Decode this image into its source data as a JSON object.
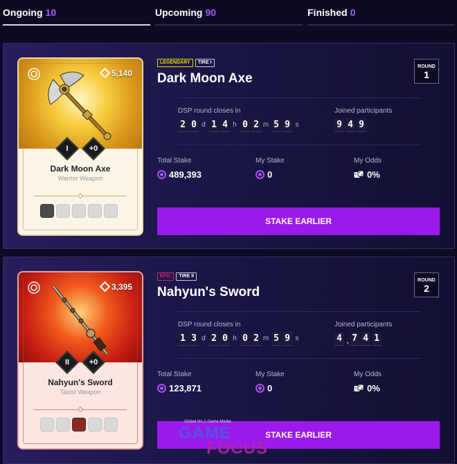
{
  "tabs": [
    {
      "label": "Ongoing",
      "count": "10",
      "active": true
    },
    {
      "label": "Upcoming",
      "count": "90",
      "active": false
    },
    {
      "label": "Finished",
      "count": "0",
      "active": false
    }
  ],
  "colors": {
    "accent": "#9b1aeb",
    "tab_count": "#a855f7",
    "background": "#0d0b24",
    "legendary": "#f0d400",
    "epic": "#d4206a"
  },
  "labels": {
    "timer_label": "DSP round closes in",
    "participants_label": "Joined participants",
    "total_stake": "Total Stake",
    "my_stake": "My Stake",
    "my_odds": "My Odds",
    "round": "ROUND"
  },
  "auctions": [
    {
      "rarity": "LEGENDARY",
      "tier_tag": "TIRE I",
      "title": "Dark Moon Axe",
      "round": "1",
      "price": "5,140",
      "item_name": "Dark Moon Axe",
      "item_type": "Warrior Weapon",
      "tier_badge": "I",
      "plus_badge": "+0",
      "timer": {
        "days": [
          "2",
          "0"
        ],
        "hours": [
          "1",
          "4"
        ],
        "minutes": [
          "0",
          "2"
        ],
        "seconds": [
          "5",
          "9"
        ]
      },
      "units": {
        "d": "d",
        "h": "h",
        "m": "m",
        "s": "s"
      },
      "participants": [
        "9",
        "4",
        "9"
      ],
      "total_stake": "489,393",
      "my_stake": "0",
      "my_odds": "0%",
      "button": "STAKE EARLIER",
      "art_icon": "axe-icon"
    },
    {
      "rarity": "EPIC",
      "tier_tag": "TIRE II",
      "title": "Nahyun's Sword",
      "round": "2",
      "price": "3,395",
      "item_name": "Nahyun's Sword",
      "item_type": "Taoist Weapon",
      "tier_badge": "II",
      "plus_badge": "+0",
      "timer": {
        "days": [
          "1",
          "3"
        ],
        "hours": [
          "2",
          "0"
        ],
        "minutes": [
          "0",
          "2"
        ],
        "seconds": [
          "5",
          "9"
        ]
      },
      "units": {
        "d": "d",
        "h": "h",
        "m": "m",
        "s": "s"
      },
      "participants": [
        "4",
        ",",
        "7",
        "4",
        "1"
      ],
      "total_stake": "123,871",
      "my_stake": "0",
      "my_odds": "0%",
      "button": "STAKE EARLIER",
      "art_icon": "sword-icon"
    }
  ],
  "watermark": {
    "tagline": "Global No.1 Game Media",
    "line1": "GAME",
    "line2": "FOCUS"
  }
}
